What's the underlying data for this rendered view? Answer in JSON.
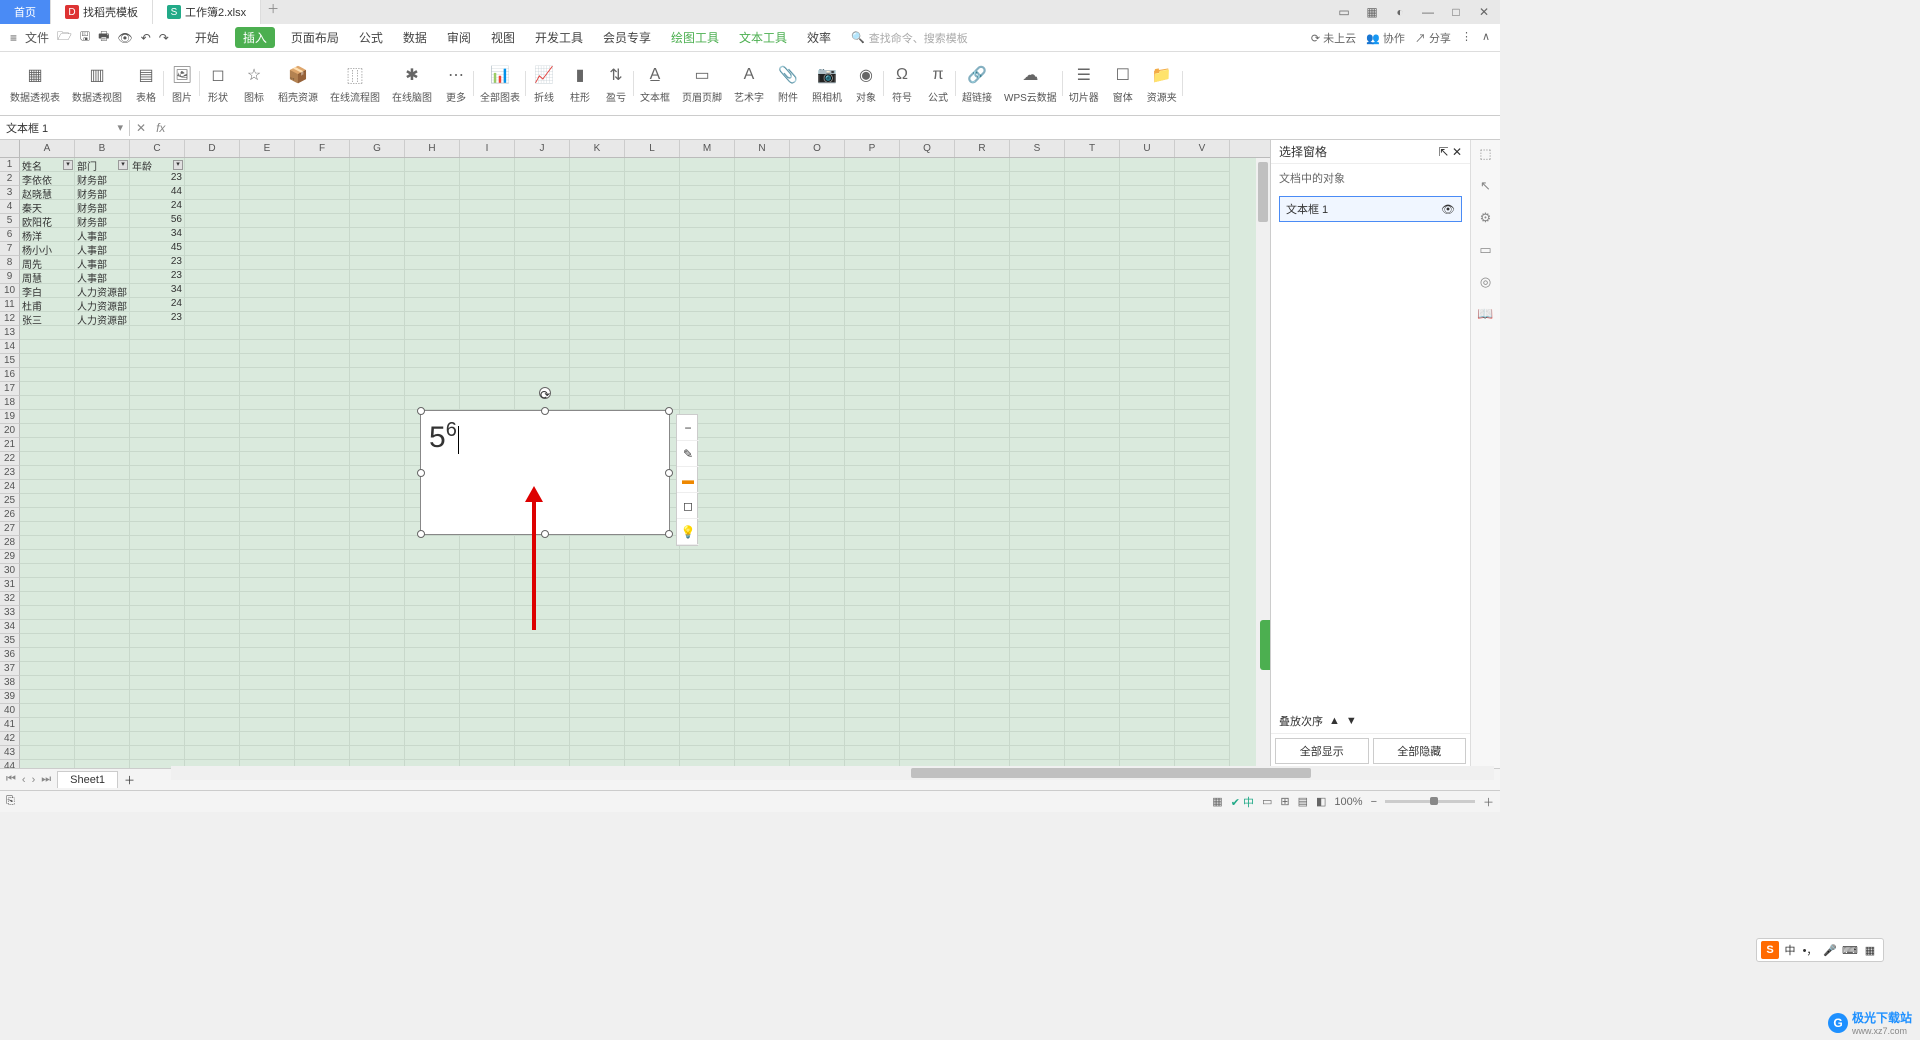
{
  "titlebar": {
    "home_tab": "首页",
    "template_tab": "找稻壳模板",
    "doc_tab": "工作簿2.xlsx"
  },
  "menubar": {
    "file": "文件",
    "items": [
      "开始",
      "插入",
      "页面布局",
      "公式",
      "数据",
      "审阅",
      "视图",
      "开发工具",
      "会员专享",
      "绘图工具",
      "文本工具",
      "效率"
    ],
    "active_index": 1,
    "green_indices": [
      9,
      10
    ],
    "search_placeholder": "查找命令、搜索模板",
    "cloud": "未上云",
    "coop": "协作",
    "share": "分享"
  },
  "ribbon": {
    "groups": [
      {
        "label": "数据透视表",
        "icon": "▦"
      },
      {
        "label": "数据透视图",
        "icon": "▥"
      },
      {
        "label": "表格",
        "icon": "▤"
      },
      {
        "label": "图片",
        "icon": "🖼"
      },
      {
        "label": "形状",
        "icon": "◻"
      },
      {
        "label": "图标",
        "icon": "☆"
      },
      {
        "label": "稻壳资源",
        "icon": "📦"
      },
      {
        "label": "在线流程图",
        "icon": "⿲"
      },
      {
        "label": "在线脑图",
        "icon": "✱"
      },
      {
        "label": "更多",
        "icon": "⋯"
      },
      {
        "label": "全部图表",
        "icon": "📊"
      },
      {
        "label": "折线",
        "icon": "📈"
      },
      {
        "label": "柱形",
        "icon": "▮"
      },
      {
        "label": "盈亏",
        "icon": "⇅"
      },
      {
        "label": "文本框",
        "icon": "A̲"
      },
      {
        "label": "页眉页脚",
        "icon": "▭"
      },
      {
        "label": "艺术字",
        "icon": "A"
      },
      {
        "label": "附件",
        "icon": "📎"
      },
      {
        "label": "照相机",
        "icon": "📷"
      },
      {
        "label": "对象",
        "icon": "◉"
      },
      {
        "label": "符号",
        "icon": "Ω"
      },
      {
        "label": "公式",
        "icon": "π"
      },
      {
        "label": "超链接",
        "icon": "🔗"
      },
      {
        "label": "WPS云数据",
        "icon": "☁"
      },
      {
        "label": "切片器",
        "icon": "☰"
      },
      {
        "label": "窗体",
        "icon": "☐"
      },
      {
        "label": "资源夹",
        "icon": "📁"
      }
    ]
  },
  "formula_bar": {
    "name_box": "文本框 1",
    "fx": "fx"
  },
  "columns": [
    "A",
    "B",
    "C",
    "D",
    "E",
    "F",
    "G",
    "H",
    "I",
    "J",
    "K",
    "L",
    "M",
    "N",
    "O",
    "P",
    "Q",
    "R",
    "S",
    "T",
    "U",
    "V"
  ],
  "rows_count": 44,
  "table": {
    "headers": [
      "姓名",
      "部门",
      "年龄"
    ],
    "rows": [
      [
        "李依依",
        "财务部",
        "23"
      ],
      [
        "赵晓慧",
        "财务部",
        "44"
      ],
      [
        "秦天",
        "财务部",
        "24"
      ],
      [
        "欧阳花",
        "财务部",
        "56"
      ],
      [
        "杨洋",
        "人事部",
        "34"
      ],
      [
        "杨小小",
        "人事部",
        "45"
      ],
      [
        "周先",
        "人事部",
        "23"
      ],
      [
        "周慧",
        "人事部",
        "23"
      ],
      [
        "李白",
        "人力资源部",
        "34"
      ],
      [
        "杜甫",
        "人力资源部",
        "24"
      ],
      [
        "张三",
        "人力资源部",
        "23"
      ]
    ]
  },
  "textbox": {
    "base": "5",
    "exponent": "6"
  },
  "selection_pane": {
    "title": "选择窗格",
    "subtitle": "文档中的对象",
    "item": "文本框 1",
    "stack_label": "叠放次序",
    "show_all": "全部显示",
    "hide_all": "全部隐藏"
  },
  "sheet_tabs": {
    "sheet1": "Sheet1"
  },
  "statusbar": {
    "zoom": "100%"
  },
  "ime": {
    "lang": "中"
  },
  "watermark": {
    "name": "极光下载站",
    "url": "www.xz7.com"
  }
}
